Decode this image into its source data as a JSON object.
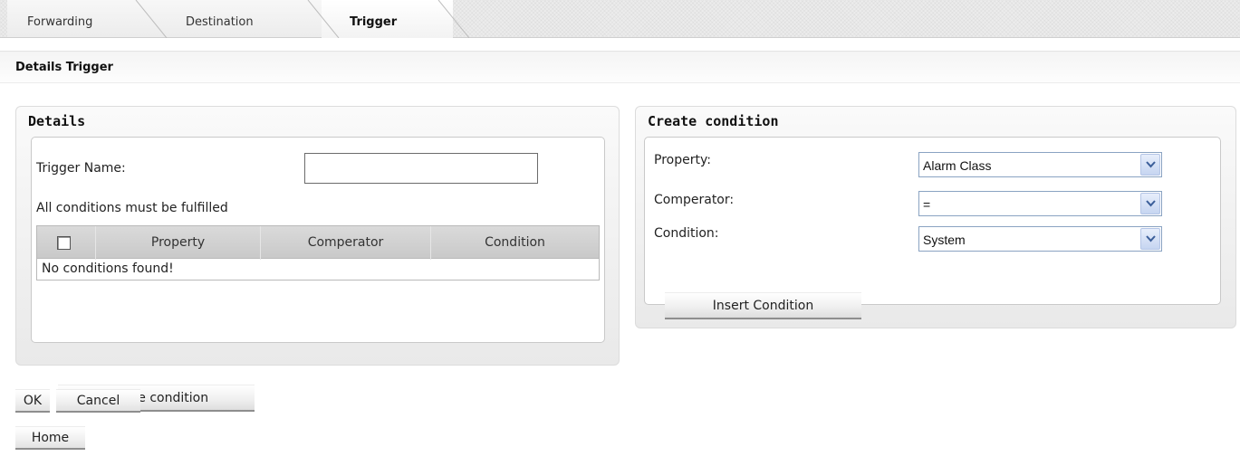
{
  "tabs": [
    {
      "label": "Forwarding",
      "active": false
    },
    {
      "label": "Destination",
      "active": false
    },
    {
      "label": "Trigger",
      "active": true
    }
  ],
  "page_title": "Details Trigger",
  "details": {
    "title": "Details",
    "trigger_name_label": "Trigger Name:",
    "trigger_name_value": "",
    "fulfilled_text": "All conditions must be fulfilled",
    "table": {
      "columns": [
        "Property",
        "Comperator",
        "Condition"
      ],
      "empty_text": "No conditions found!"
    },
    "delete_button": "Delete condition"
  },
  "create_condition": {
    "title": "Create condition",
    "property_label": "Property:",
    "property_value": "Alarm Class",
    "comperator_label": "Comperator:",
    "comperator_value": "=",
    "condition_label": "Condition:",
    "condition_value": "System",
    "insert_button": "Insert Condition"
  },
  "actions": {
    "ok": "OK",
    "cancel": "Cancel",
    "home": "Home"
  },
  "colors": {
    "select_arrow_bg": "#c6d5f1",
    "select_border": "#8aa3c2",
    "button_underline": "#8e8e8e"
  }
}
